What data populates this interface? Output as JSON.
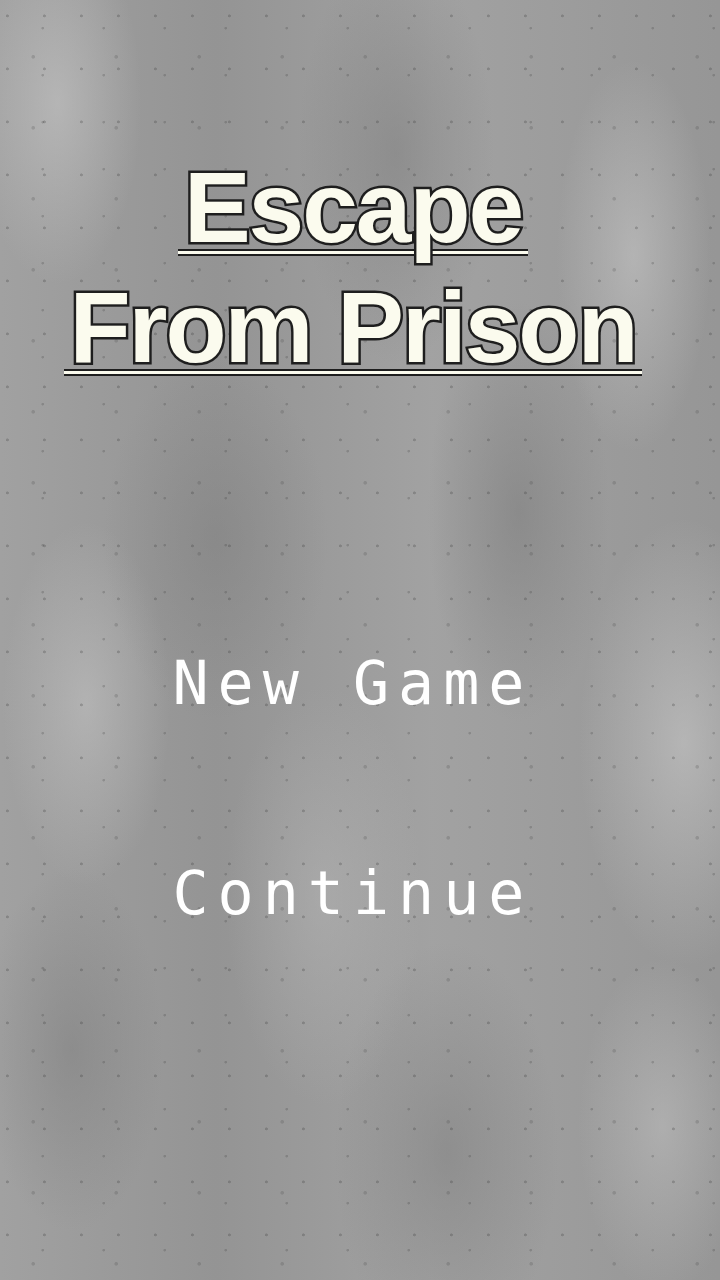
{
  "title": {
    "lines": [
      "Escape",
      "From Prison"
    ]
  },
  "menu": [
    {
      "label": "New Game"
    },
    {
      "label": "Continue"
    }
  ]
}
